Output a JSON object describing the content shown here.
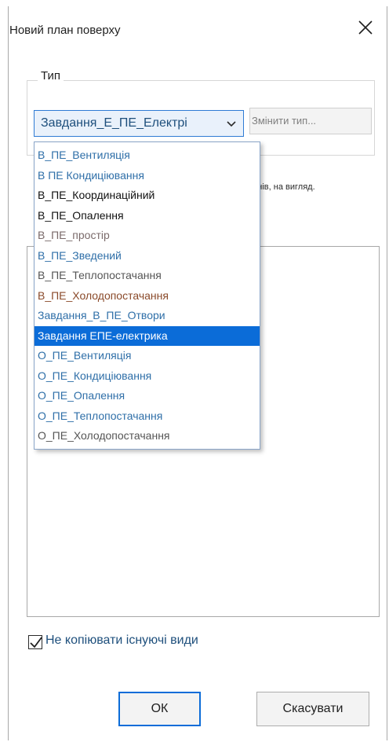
{
  "window": {
    "title": "Новий план поверху"
  },
  "type_group": {
    "label": "Тип",
    "selected_value": "Завдання_Е_ПЕ_Електрі",
    "change_type_label": "Змінити тип..."
  },
  "hint_text": "івнів, на вигляд.",
  "dropdown": {
    "options": [
      {
        "label": "В_ПЕ_Вентиляція",
        "color": "#2f6fa8"
      },
      {
        "label": "В  ПЕ  Кондиціювання",
        "color": "#2f6fa8"
      },
      {
        "label": "В_ПЕ_Координаційний",
        "color": "#111111"
      },
      {
        "label": "В_ПЕ_Опалення",
        "color": "#111111"
      },
      {
        "label": "В_ПЕ_простір",
        "color": "#7a6a6a"
      },
      {
        "label": "В_ПЕ_Зведений",
        "color": "#2f6fa8"
      },
      {
        "label": "В_ПЕ_Теплопостачання",
        "color": "#555555"
      },
      {
        "label": "В_ПЕ_Холодопостачання",
        "color": "#8a4a2a"
      },
      {
        "label": "Завдання_В_ПЕ_Отвори",
        "color": "#2f6fa8"
      },
      {
        "label": "Завдання ЕПЕ-електрика",
        "color": "#ffffff",
        "selected": true
      },
      {
        "label": "О_ПЕ_Вентиляція",
        "color": "#2f6fa8"
      },
      {
        "label": "О_ПЕ_Кондиціювання",
        "color": "#2f6fa8"
      },
      {
        "label": "О_ПЕ_Опалення",
        "color": "#2f6fa8"
      },
      {
        "label": "О_ПЕ_Теплопостачання",
        "color": "#2f6fa8"
      },
      {
        "label": "О_ПЕ_Холодопостачання",
        "color": "#555555"
      }
    ]
  },
  "options": {
    "dont_copy_views_label": "Не копіювати існуючі види",
    "dont_copy_views_checked": true
  },
  "buttons": {
    "ok_label": "ОК",
    "cancel_label": "Скасувати"
  },
  "colors": {
    "accent": "#0b6cd8",
    "text_blue": "#1e4f7c"
  }
}
